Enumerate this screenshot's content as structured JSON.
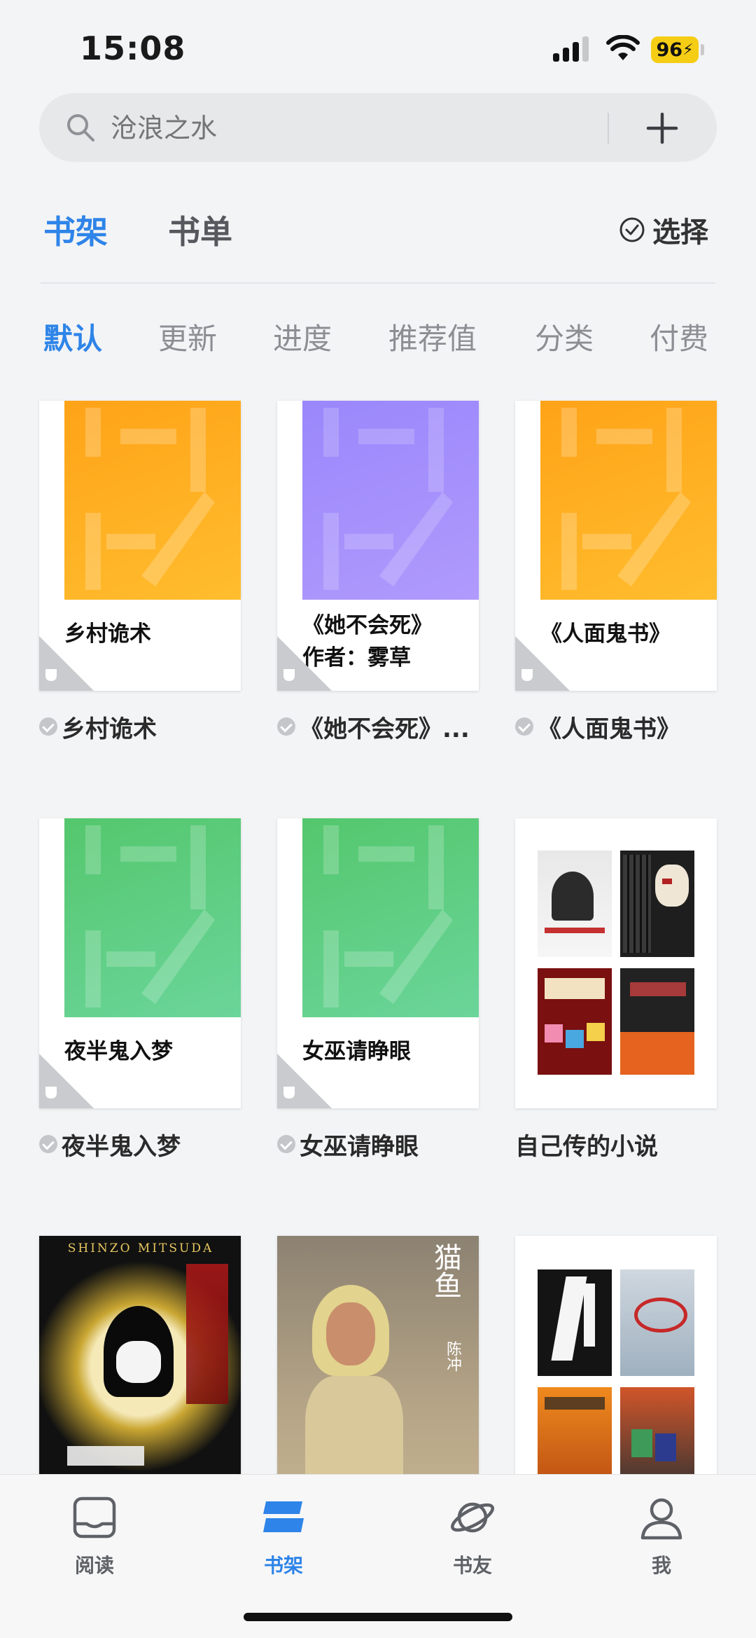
{
  "status_bar": {
    "time": "15:08",
    "battery": "96"
  },
  "search": {
    "placeholder": "沧浪之水",
    "icon": "search-icon",
    "add_icon": "plus-icon"
  },
  "tabs": {
    "bookshelf": "书架",
    "booklist": "书单",
    "select": "选择"
  },
  "sort_tabs": [
    "默认",
    "更新",
    "进度",
    "推荐值",
    "分类",
    "付费"
  ],
  "books": [
    {
      "cover_title": "乡村诡术",
      "label": "乡村诡术",
      "cover_color": "#ffb020",
      "checked": true
    },
    {
      "cover_title": "《她不会死》",
      "cover_subtitle": "作者：雾草",
      "label": "《她不会死》...",
      "cover_color": "#a08cfb",
      "checked": true
    },
    {
      "cover_title": "《人面鬼书》",
      "label": "《人面鬼书》",
      "cover_color": "#ffb020",
      "checked": true
    },
    {
      "cover_title": "夜半鬼入梦",
      "label": "夜半鬼入梦",
      "cover_color": "#5dcf80",
      "checked": true
    },
    {
      "cover_title": "女巫请睁眼",
      "label": "女巫请睁眼",
      "cover_color": "#5dcf80",
      "checked": true
    },
    {
      "label": "自己传的小说",
      "checked": false,
      "type": "collection"
    },
    {
      "cover_text": "SHINZO MITSUDA",
      "label": "",
      "type": "image"
    },
    {
      "cover_text": "猫鱼",
      "cover_author": "陈冲",
      "label": "",
      "type": "image"
    },
    {
      "label": "",
      "type": "collection"
    }
  ],
  "bottom_nav": [
    {
      "label": "阅读",
      "icon": "book-open-icon",
      "active": false
    },
    {
      "label": "书架",
      "icon": "bookshelf-icon",
      "active": true
    },
    {
      "label": "书友",
      "icon": "planet-icon",
      "active": false
    },
    {
      "label": "我",
      "icon": "person-icon",
      "active": false
    }
  ],
  "colors": {
    "accent": "#2e84e8",
    "background": "#f3f4f6"
  }
}
